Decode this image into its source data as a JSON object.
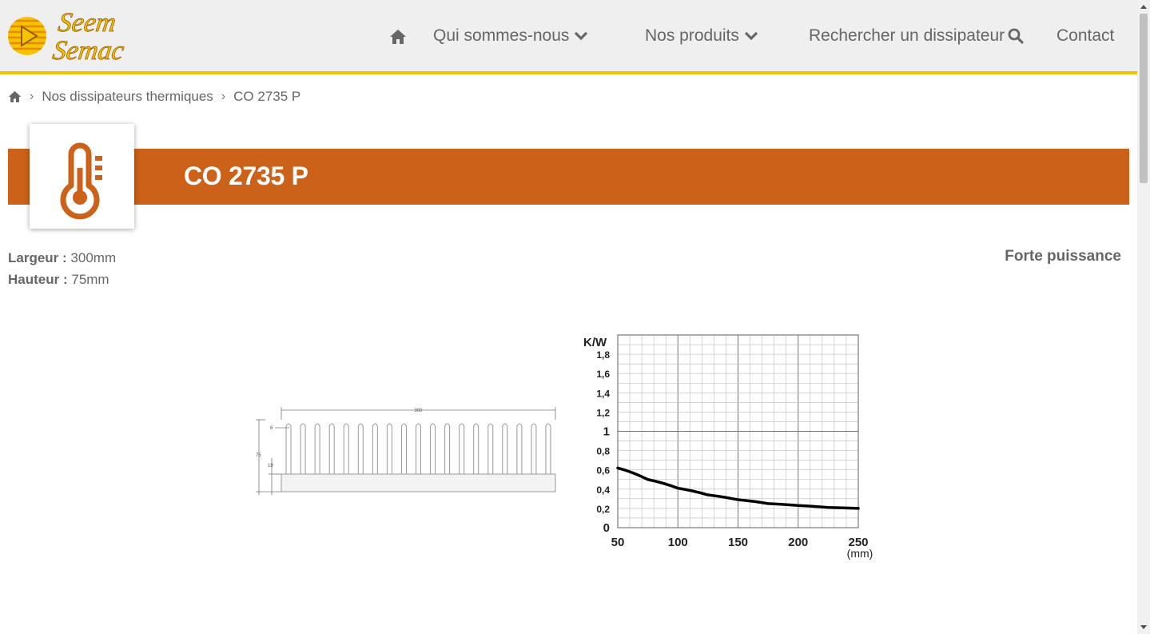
{
  "header": {
    "logo": {
      "line1": "Seem",
      "line2": "Semac"
    },
    "nav": [
      {
        "label": "",
        "icon": "home-icon"
      },
      {
        "label": "Qui sommes-nous",
        "icon": "chevron-down-icon"
      },
      {
        "label": "Nos produits",
        "icon": "chevron-down-icon"
      },
      {
        "label": "Rechercher un dissipateur",
        "icon": "search-icon"
      },
      {
        "label": "Contact"
      }
    ]
  },
  "breadcrumb": {
    "home_icon": "home-icon",
    "items": [
      "Nos dissipateurs thermiques",
      "CO 2735 P"
    ]
  },
  "product": {
    "title": "CO 2735 P",
    "icon": "thermometer-icon",
    "specs": [
      {
        "label": "Largeur :",
        "value": "300mm"
      },
      {
        "label": "Hauteur :",
        "value": "75mm"
      }
    ],
    "category": "Forte puissance"
  },
  "drawing": {
    "dim_width": "300",
    "dim_height": "75",
    "dim_gap": "6",
    "dim_base": "19",
    "fin_count": 19
  },
  "chart_data": {
    "type": "line",
    "title": "",
    "ylabel": "K/W",
    "xlabel": "(mm)",
    "x_ticks": [
      "50",
      "100",
      "150",
      "200",
      "250"
    ],
    "y_ticks": [
      "0",
      "0,2",
      "0,4",
      "0,6",
      "0,8",
      "1",
      "1,2",
      "1,4",
      "1,6",
      "1,8"
    ],
    "xlim": [
      50,
      250
    ],
    "ylim": [
      0,
      2
    ],
    "grid": true,
    "series": [
      {
        "x": [
          50,
          75,
          100,
          125,
          150,
          175,
          200,
          225,
          250
        ],
        "y": [
          0.62,
          0.5,
          0.41,
          0.34,
          0.29,
          0.25,
          0.23,
          0.21,
          0.2
        ]
      }
    ],
    "colors": {
      "curve": "#000000",
      "grid": "#888888"
    }
  },
  "colors": {
    "accent": "#cc6119",
    "header_border": "#f5c400",
    "logo_yellow": "#f5c400",
    "logo_orange": "#e88a00"
  }
}
